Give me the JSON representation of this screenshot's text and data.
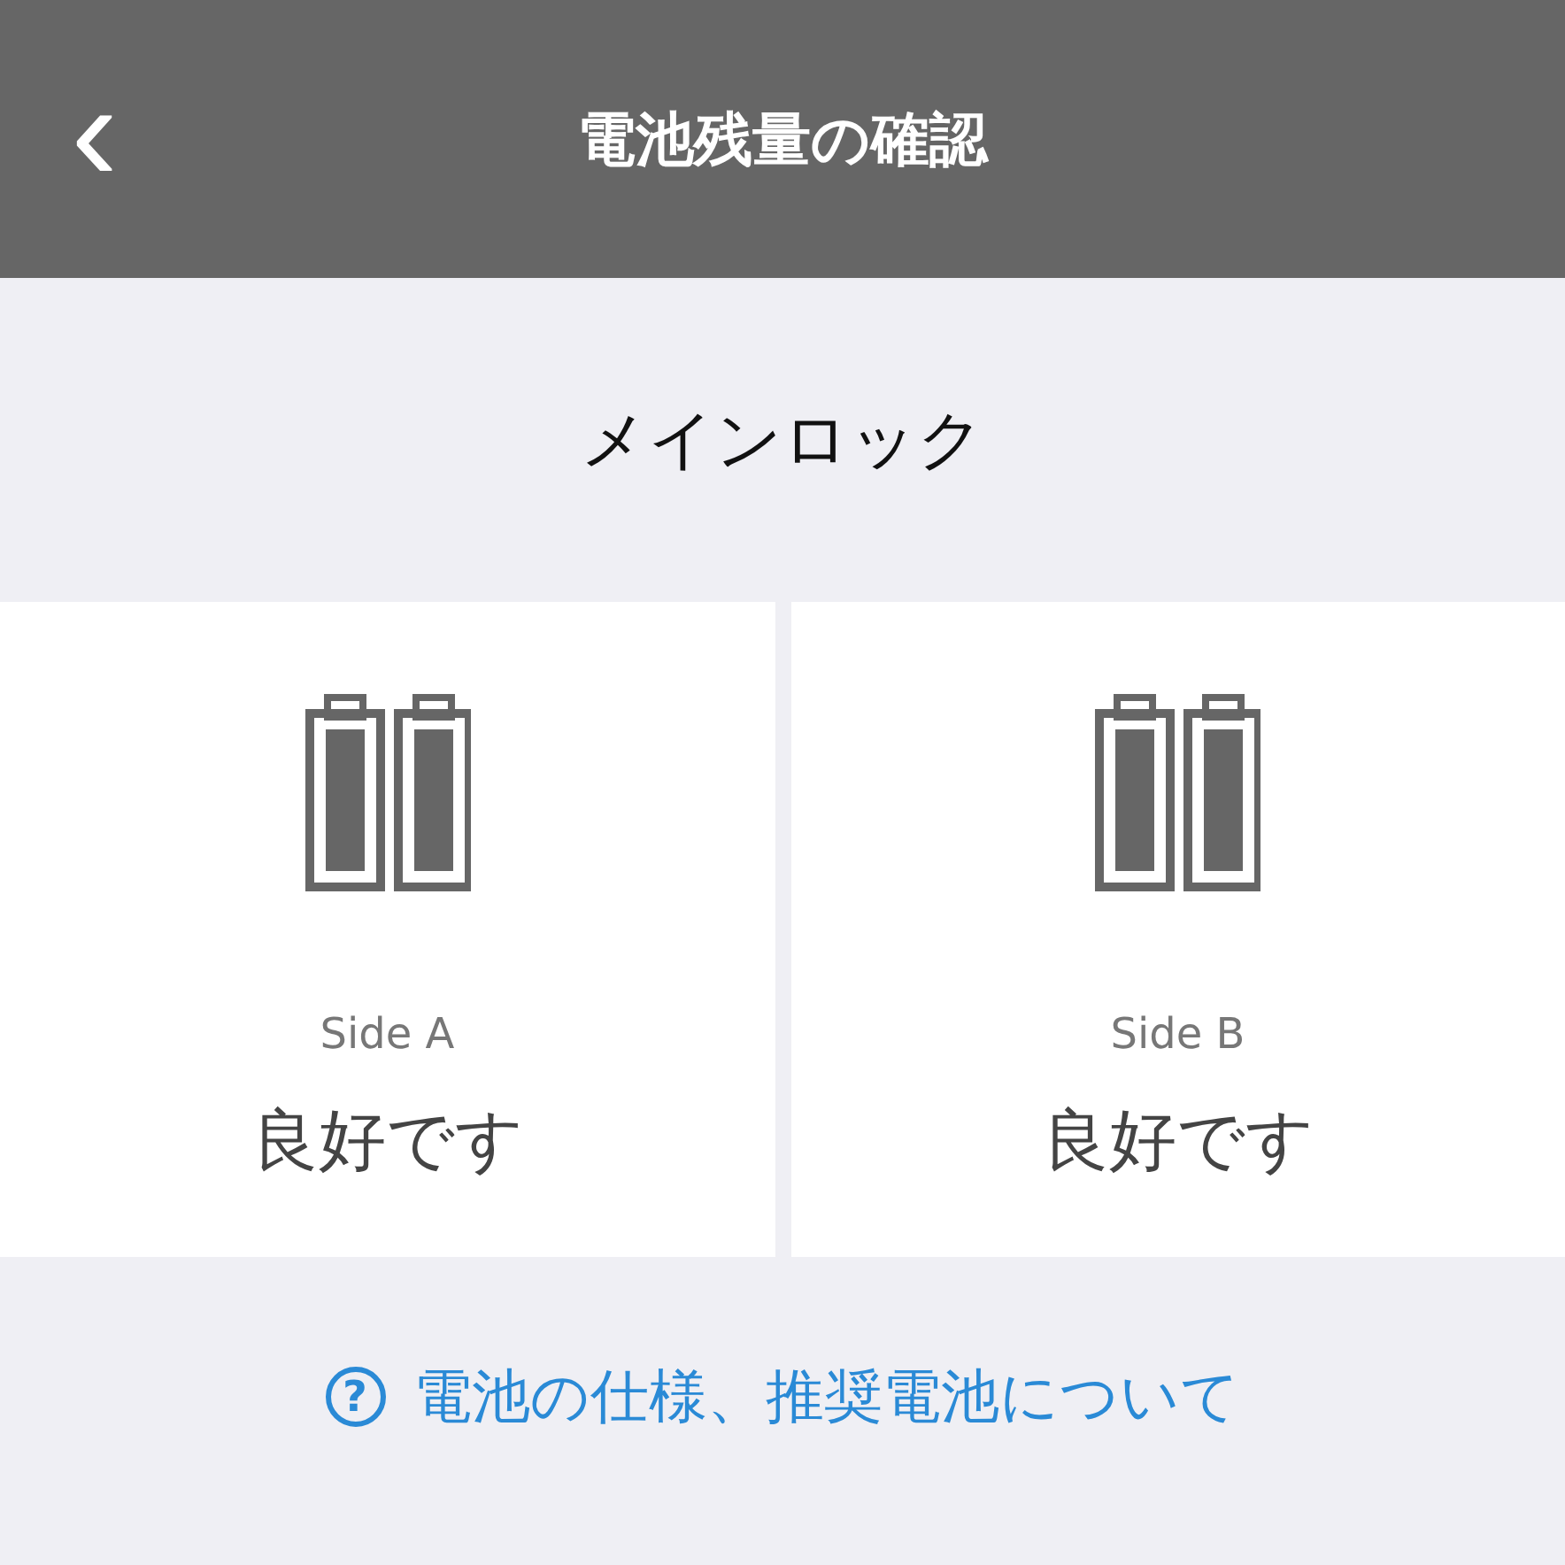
{
  "header": {
    "back": "‹",
    "title": "電池残量の確認"
  },
  "section_title": "メインロック",
  "sides": [
    {
      "label": "Side A",
      "status": "良好です"
    },
    {
      "label": "Side B",
      "status": "良好です"
    }
  ],
  "link": {
    "icon": "?",
    "text": "電池の仕様、推奨電池について"
  }
}
